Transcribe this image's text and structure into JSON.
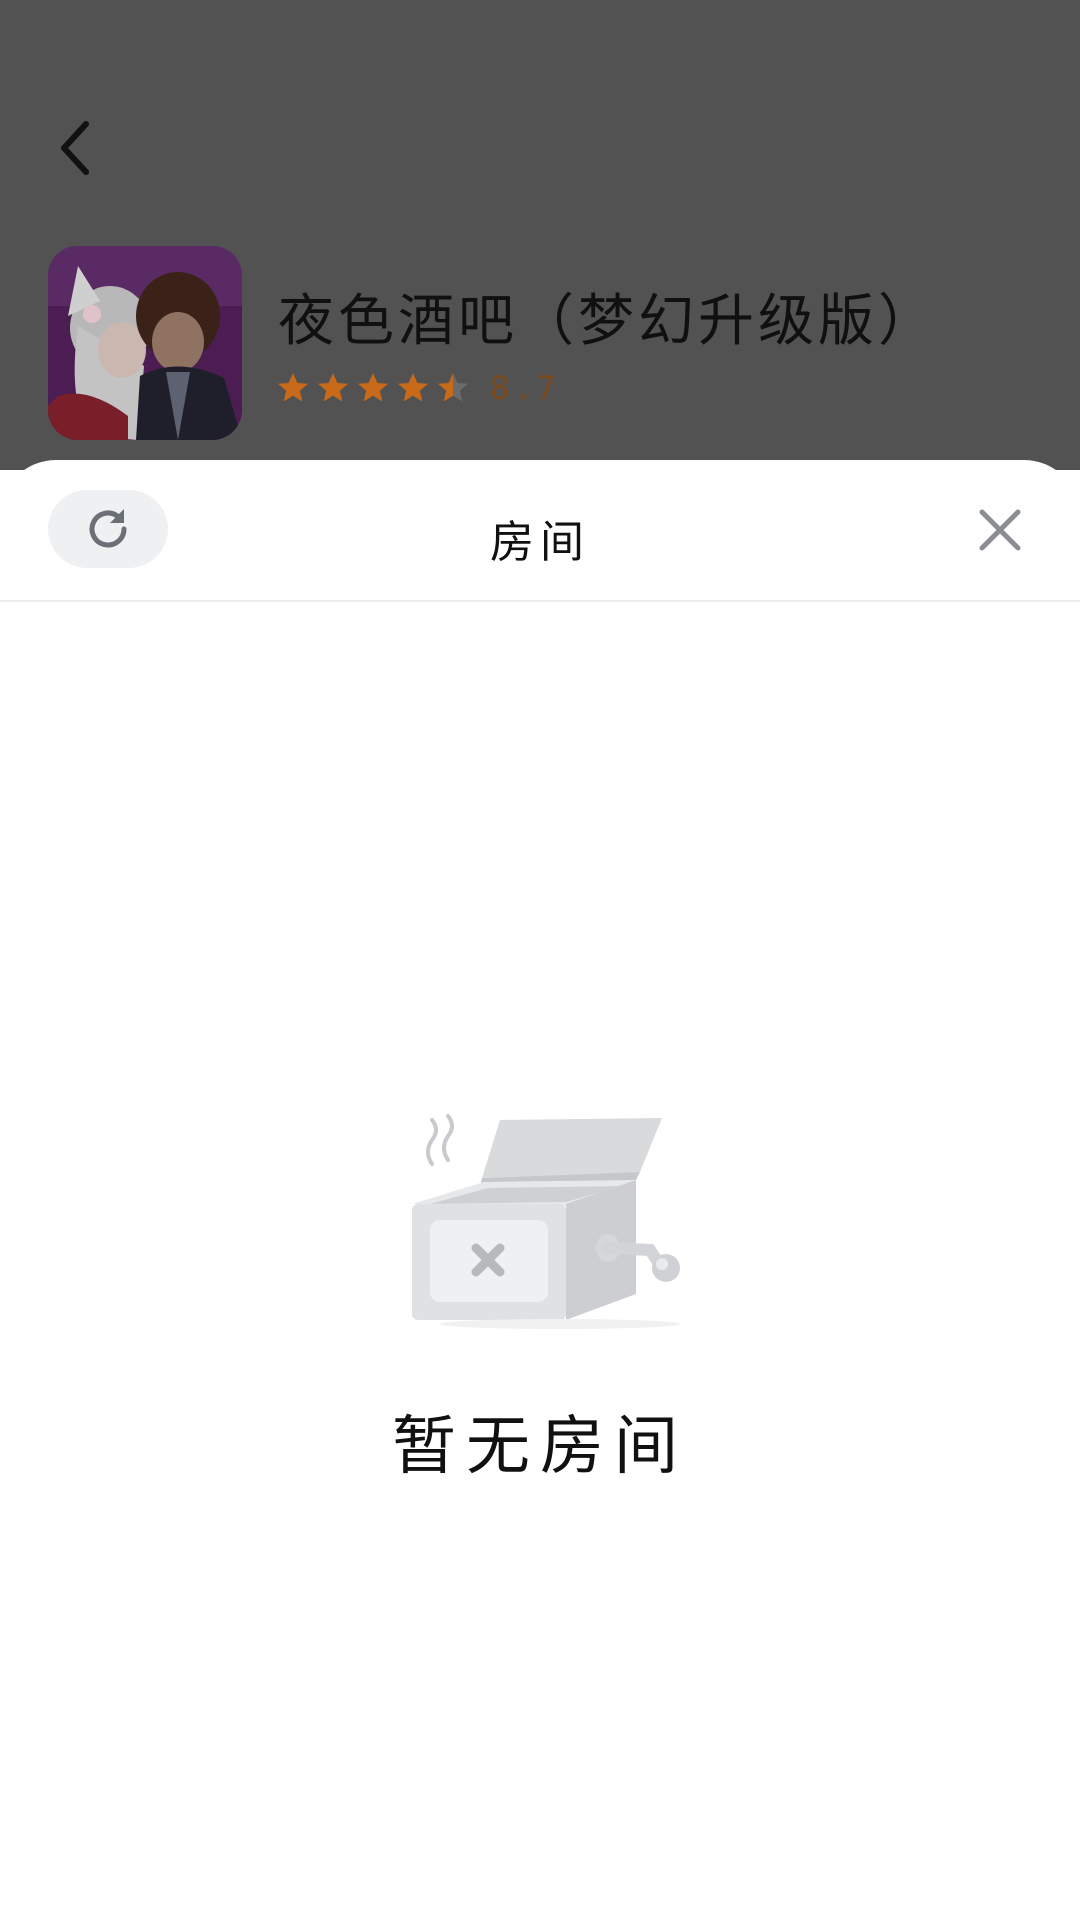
{
  "game": {
    "title": "夜色酒吧（梦幻升级版）",
    "rating": 8.7,
    "rating_text": "8.7",
    "stars": 4.5
  },
  "sheet": {
    "title": "房间",
    "empty_text": "暂无房间"
  },
  "icons": {
    "back": "chevron-left-icon",
    "refresh": "refresh-icon",
    "close": "close-icon",
    "empty": "empty-box-icon"
  },
  "colors": {
    "overlay": "#525252",
    "star": "#c86a1a",
    "star_empty": "#6b6b6b",
    "rating_text": "#7a4a1c",
    "refresh_bg": "#eef0f2"
  }
}
